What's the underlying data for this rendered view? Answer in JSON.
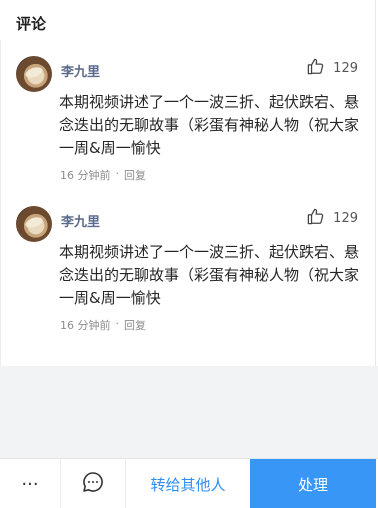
{
  "section": {
    "title": "评论"
  },
  "comments": [
    {
      "author": "李九里",
      "likes": "129",
      "text": "本期视频讲述了一个一波三折、起伏跌宕、悬念迭出的无聊故事（彩蛋有神秘人物（祝大家一周&周一愉快",
      "time": "16 分钟前",
      "dot": "·",
      "reply": "回复",
      "avatar_icon": "user-avatar-icon",
      "like_icon": "thumbs-up-icon"
    },
    {
      "author": "李九里",
      "likes": "129",
      "text": "本期视频讲述了一个一波三折、起伏跌宕、悬念迭出的无聊故事（彩蛋有神秘人物（祝大家一周&周一愉快",
      "time": "16 分钟前",
      "dot": "·",
      "reply": "回复",
      "avatar_icon": "user-avatar-icon",
      "like_icon": "thumbs-up-icon"
    }
  ],
  "bottom_bar": {
    "more_label": "···",
    "more_icon": "more-icon",
    "chat_icon": "chat-bubble-icon",
    "forward_label": "转给其他人",
    "handle_label": "处理",
    "accent_color": "#3796f6"
  }
}
